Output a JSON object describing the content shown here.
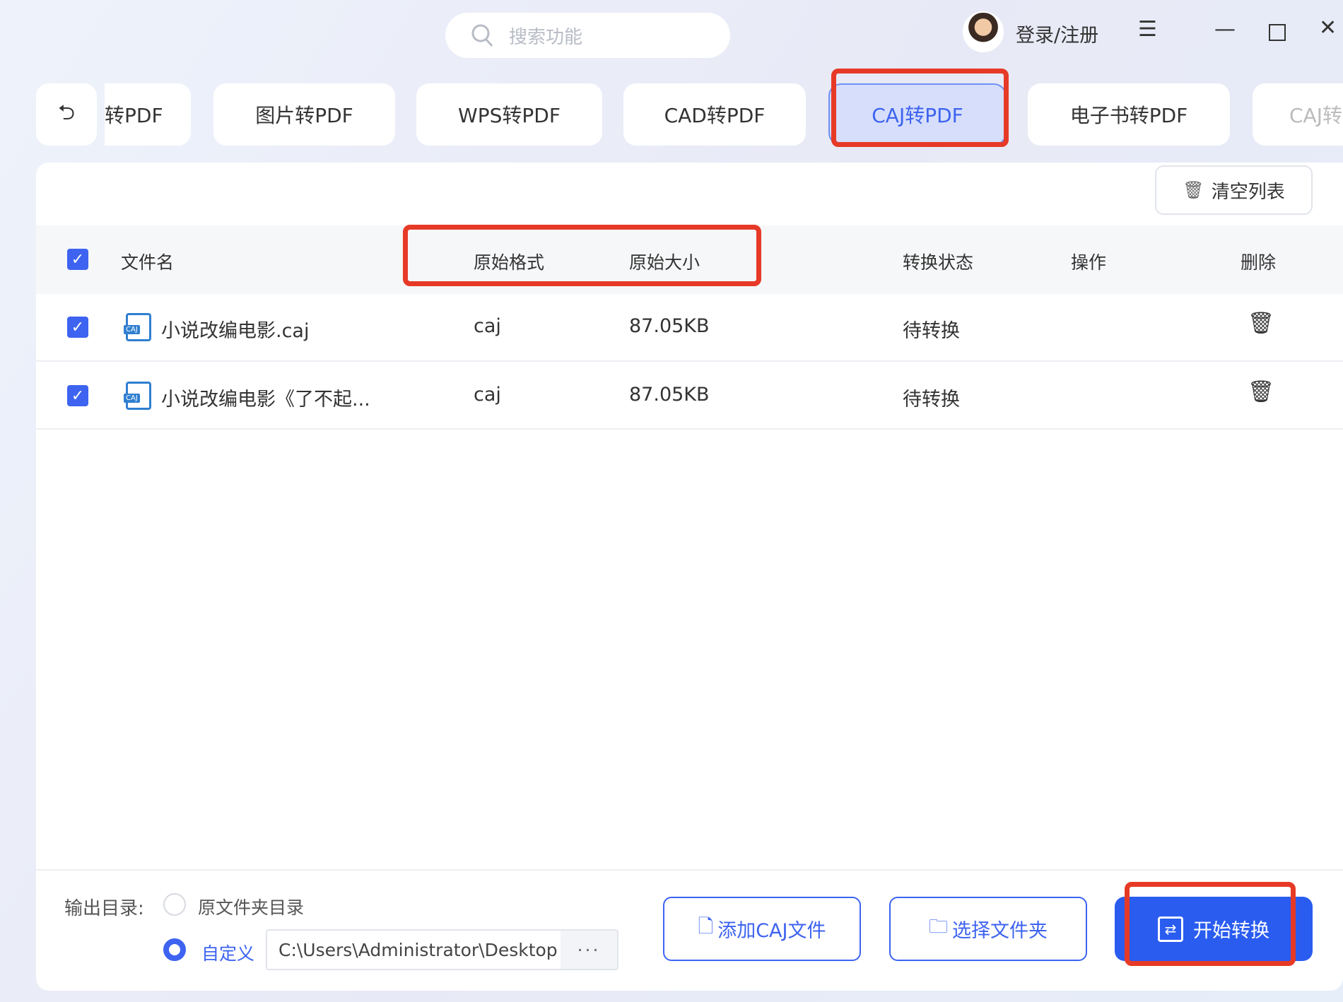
{
  "header": {
    "search_placeholder": "搜索功能",
    "login": "登录/注册"
  },
  "back_label": "⮌",
  "tabs": [
    {
      "label": "转PDF"
    },
    {
      "label": "图片转PDF"
    },
    {
      "label": "WPS转PDF"
    },
    {
      "label": "CAD转PDF"
    },
    {
      "label": "CAJ转PDF"
    },
    {
      "label": "电子书转PDF"
    },
    {
      "label": "CAJ转"
    }
  ],
  "toolbar": {
    "clear_label": "清空列表"
  },
  "table": {
    "columns": [
      "文件名",
      "原始格式",
      "原始大小",
      "转换状态",
      "操作",
      "删除"
    ],
    "rows": [
      {
        "name": "小说改编电影.caj",
        "format": "caj",
        "size": "87.05KB",
        "status": "待转换"
      },
      {
        "name": "小说改编电影《了不起...",
        "format": "caj",
        "size": "87.05KB",
        "status": "待转换"
      }
    ],
    "file_badge": "CAJ"
  },
  "output": {
    "label": "输出目录:",
    "option_original": "原文件夹目录",
    "option_custom": "自定义",
    "path": "C:\\Users\\Administrator\\Desktop",
    "browse": "···"
  },
  "actions": {
    "add": "添加CAJ文件",
    "folder": "选择文件夹",
    "start": "开始转换"
  },
  "colors": {
    "accent": "#3d63f0",
    "highlight": "#e63a27"
  }
}
